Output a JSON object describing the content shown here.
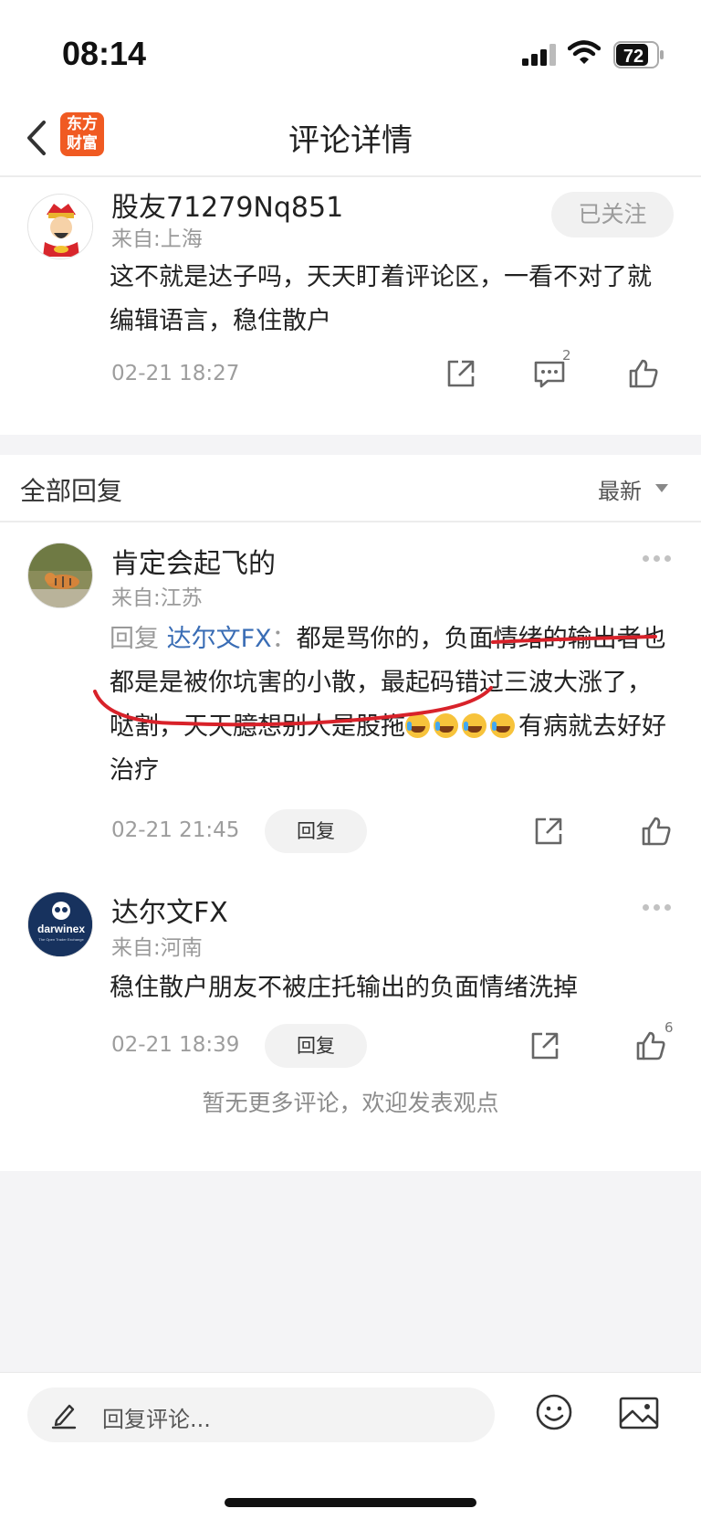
{
  "status": {
    "time": "08:14",
    "battery": "72"
  },
  "nav": {
    "title": "评论详情",
    "logo_line1": "东方",
    "logo_line2": "财富"
  },
  "main_comment": {
    "user": "股友71279Nq851",
    "location": "来自:上海",
    "follow_label": "已关注",
    "text": "这不就是达子吗，天天盯着评论区，一看不对了就编辑语言，稳住散户",
    "date": "02-21 18:27",
    "comment_count": "2"
  },
  "replies_header": {
    "label": "全部回复",
    "sort": "最新"
  },
  "replies": [
    {
      "user": "肯定会起飞的",
      "location": "来自:江苏",
      "reply_prefix": "回复",
      "reply_to": "达尔文FX",
      "colon": "：",
      "text": "都是骂你的，负面情绪的输出者也都是是被你坑害的小散，最起码错过三波大涨了，哒割，天天臆想别人是股拖",
      "text_after": "有病就去好好治疗",
      "date": "02-21 21:45",
      "reply_label": "回复"
    },
    {
      "user": "达尔文FX",
      "location": "来自:河南",
      "avatar_text": "darwinex",
      "avatar_sub": "The Open Trader Exchange",
      "text": "稳住散户朋友不被庄托输出的负面情绪洗掉",
      "date": "02-21 18:39",
      "reply_label": "回复",
      "like_count": "6"
    }
  ],
  "no_more": "暂无更多评论，欢迎发表观点",
  "bottom": {
    "placeholder": "回复评论..."
  },
  "colors": {
    "link": "#3a6db5",
    "logo": "#f05a22",
    "annotation": "#d8222a"
  },
  "icons": [
    "chevron-left-icon",
    "signal-icon",
    "wifi-icon",
    "battery-icon",
    "share-icon",
    "comment-icon",
    "thumbs-up-icon",
    "more-icon",
    "caret-down-icon",
    "pencil-icon",
    "emoji-icon",
    "image-icon"
  ]
}
